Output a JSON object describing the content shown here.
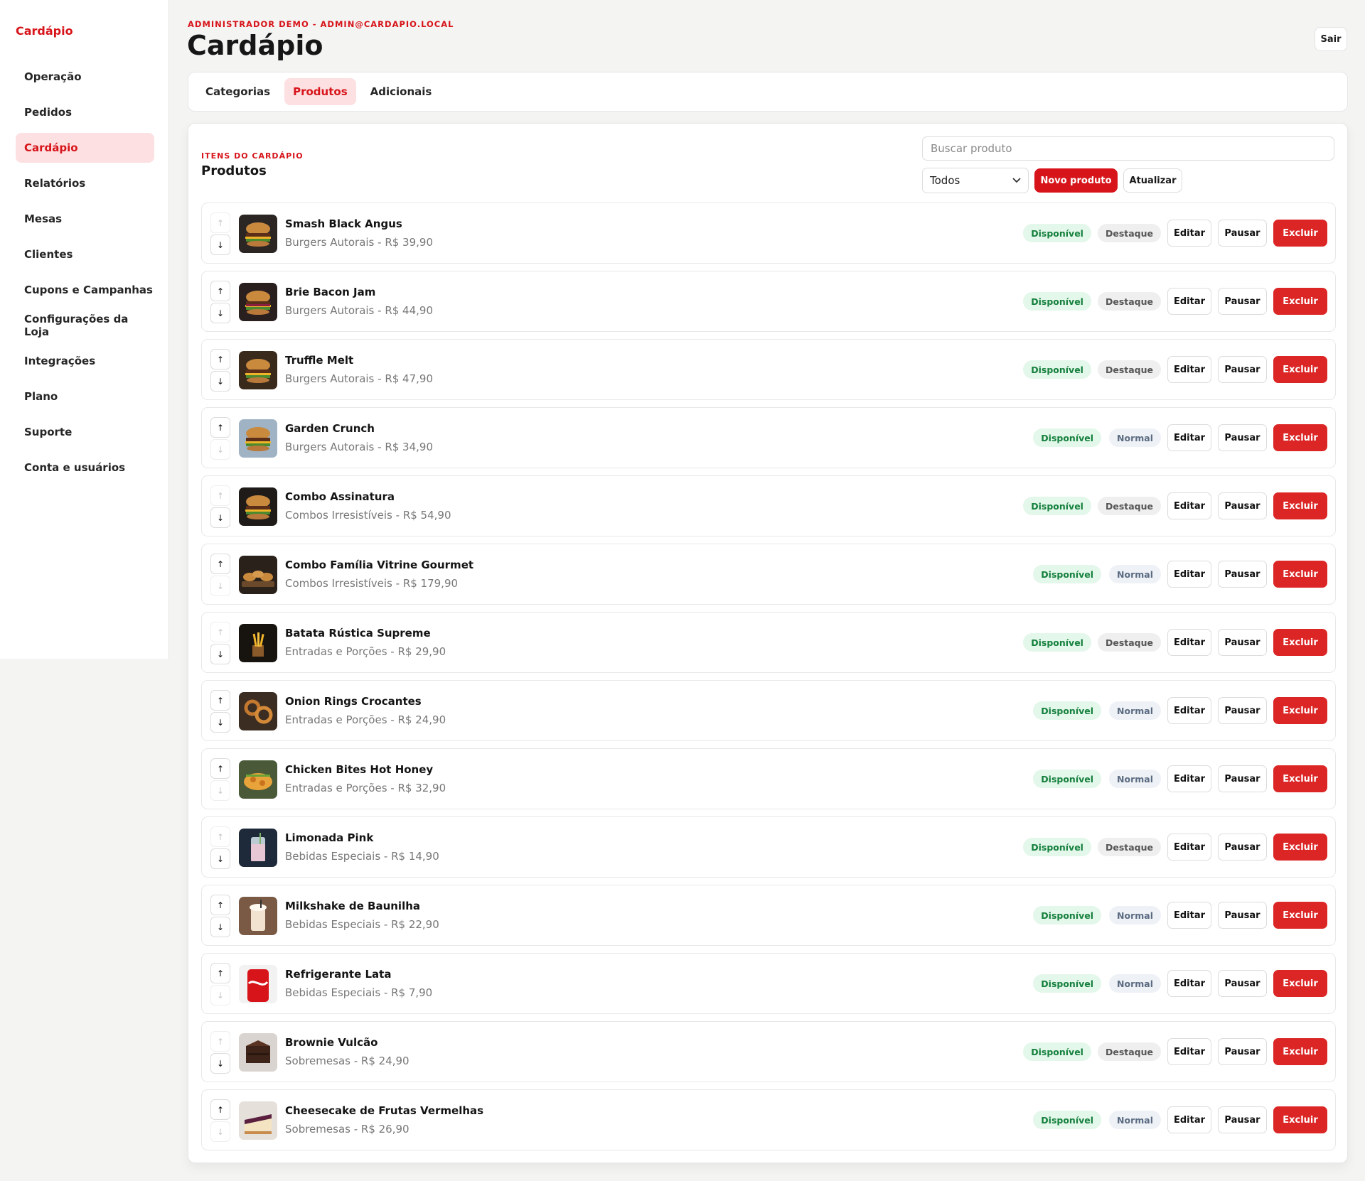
{
  "sidebar": {
    "brand": "Cardápio",
    "items": [
      {
        "label": "Operação",
        "active": false
      },
      {
        "label": "Pedidos",
        "active": false
      },
      {
        "label": "Cardápio",
        "active": true
      },
      {
        "label": "Relatórios",
        "active": false
      },
      {
        "label": "Mesas",
        "active": false
      },
      {
        "label": "Clientes",
        "active": false
      },
      {
        "label": "Cupons e Campanhas",
        "active": false
      },
      {
        "label": "Configurações da Loja",
        "active": false
      },
      {
        "label": "Integrações",
        "active": false
      },
      {
        "label": "Plano",
        "active": false
      },
      {
        "label": "Suporte",
        "active": false
      },
      {
        "label": "Conta e usuários",
        "active": false
      }
    ]
  },
  "header": {
    "user": "ADMINISTRADOR DEMO - ADMIN@CARDAPIO.LOCAL",
    "title": "Cardápio",
    "logout_label": "Sair"
  },
  "tabs": [
    {
      "label": "Categorias",
      "active": false
    },
    {
      "label": "Produtos",
      "active": true
    },
    {
      "label": "Adicionais",
      "active": false
    }
  ],
  "section": {
    "kicker": "ITENS DO CARDÁPIO",
    "title": "Produtos",
    "search_placeholder": "Buscar produto",
    "filter_value": "Todos",
    "new_label": "Novo produto",
    "refresh_label": "Atualizar"
  },
  "row_actions": {
    "edit": "Editar",
    "pause": "Pausar",
    "delete": "Excluir",
    "up_arrow": "↑",
    "down_arrow": "↓"
  },
  "products": [
    {
      "name": "Smash Black Angus",
      "category": "Burgers Autorais - R$ 39,90",
      "status": "Disponível",
      "tag": "Destaque",
      "up": false,
      "down": true,
      "thumb": "burger"
    },
    {
      "name": "Brie Bacon Jam",
      "category": "Burgers Autorais - R$ 44,90",
      "status": "Disponível",
      "tag": "Destaque",
      "up": true,
      "down": true,
      "thumb": "burger-red"
    },
    {
      "name": "Truffle Melt",
      "category": "Burgers Autorais - R$ 47,90",
      "status": "Disponível",
      "tag": "Destaque",
      "up": true,
      "down": true,
      "thumb": "burger-fries"
    },
    {
      "name": "Garden Crunch",
      "category": "Burgers Autorais - R$ 34,90",
      "status": "Disponível",
      "tag": "Normal",
      "up": true,
      "down": false,
      "thumb": "burger-light"
    },
    {
      "name": "Combo Assinatura",
      "category": "Combos Irresistíveis - R$ 54,90",
      "status": "Disponível",
      "tag": "Destaque",
      "up": false,
      "down": true,
      "thumb": "combo-dark"
    },
    {
      "name": "Combo Família Vitrine Gourmet",
      "category": "Combos Irresistíveis - R$ 179,90",
      "status": "Disponível",
      "tag": "Normal",
      "up": true,
      "down": false,
      "thumb": "combo-board"
    },
    {
      "name": "Batata Rústica Supreme",
      "category": "Entradas e Porções - R$ 29,90",
      "status": "Disponível",
      "tag": "Destaque",
      "up": false,
      "down": true,
      "thumb": "fries"
    },
    {
      "name": "Onion Rings Crocantes",
      "category": "Entradas e Porções - R$ 24,90",
      "status": "Disponível",
      "tag": "Normal",
      "up": true,
      "down": true,
      "thumb": "rings"
    },
    {
      "name": "Chicken Bites Hot Honey",
      "category": "Entradas e Porções - R$ 32,90",
      "status": "Disponível",
      "tag": "Normal",
      "up": true,
      "down": false,
      "thumb": "chicken"
    },
    {
      "name": "Limonada Pink",
      "category": "Bebidas Especiais - R$ 14,90",
      "status": "Disponível",
      "tag": "Destaque",
      "up": false,
      "down": true,
      "thumb": "lemonade"
    },
    {
      "name": "Milkshake de Baunilha",
      "category": "Bebidas Especiais - R$ 22,90",
      "status": "Disponível",
      "tag": "Normal",
      "up": true,
      "down": true,
      "thumb": "milkshake"
    },
    {
      "name": "Refrigerante Lata",
      "category": "Bebidas Especiais - R$ 7,90",
      "status": "Disponível",
      "tag": "Normal",
      "up": true,
      "down": false,
      "thumb": "can"
    },
    {
      "name": "Brownie Vulcão",
      "category": "Sobremesas - R$ 24,90",
      "status": "Disponível",
      "tag": "Destaque",
      "up": false,
      "down": true,
      "thumb": "brownie"
    },
    {
      "name": "Cheesecake de Frutas Vermelhas",
      "category": "Sobremesas - R$ 26,90",
      "status": "Disponível",
      "tag": "Normal",
      "up": true,
      "down": false,
      "thumb": "cheesecake"
    }
  ]
}
